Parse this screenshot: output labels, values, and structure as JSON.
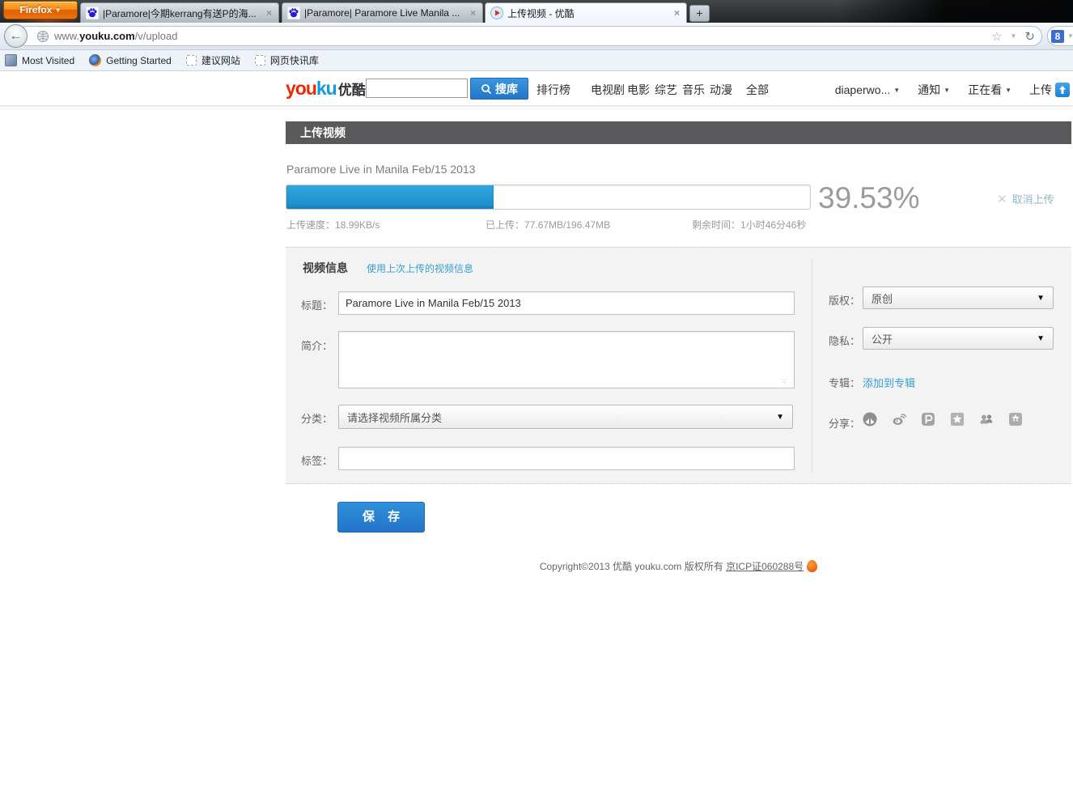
{
  "browser": {
    "firefox_button": "Firefox",
    "tabs": [
      {
        "title": "|Paramore|今期kerrang有送P的海...",
        "icon": "baidu-paw-icon",
        "active": false
      },
      {
        "title": "|Paramore| Paramore Live Manila ...",
        "icon": "baidu-paw-icon",
        "active": false
      },
      {
        "title": "上传视频 - 优酷",
        "icon": "youku-play-icon",
        "active": true
      }
    ],
    "url": {
      "prefix": "www.",
      "domain": "youku.com",
      "path": "/v/upload"
    },
    "bookmarks": [
      {
        "label": "Most Visited"
      },
      {
        "label": "Getting Started"
      },
      {
        "label": "建议网站"
      },
      {
        "label": "网页快讯库"
      }
    ]
  },
  "glyphs": {
    "caret_down": "▼",
    "close": "×",
    "plus": "+",
    "back_arrow": "←",
    "star": "☆",
    "reload": "↻",
    "google_8": "8",
    "cancel_x": "✕",
    "grip": "⁙"
  },
  "header": {
    "logo_you": "you",
    "logo_ku": "ku",
    "logo_cn": "优酷",
    "search_value": "",
    "search_button": "搜库",
    "ranking": "排行榜",
    "nav": [
      "电视剧",
      "电影",
      "综艺",
      "音乐",
      "动漫",
      "全部"
    ],
    "username": "diaperwo...",
    "notifications": "通知",
    "watching": "正在看",
    "upload": "上传"
  },
  "upload": {
    "section_title": "上传视频",
    "video_title": "Paramore Live in Manila Feb/15 2013",
    "percent_label": "39.53%",
    "percent_value": 39.53,
    "cancel_label": "取消上传",
    "speed_label": "上传速度：",
    "speed_value": "18.99KB/s",
    "uploaded_label": "已上传：",
    "uploaded_value": "77.67MB/196.47MB",
    "remaining_label": "剩余时间：",
    "remaining_value": "1小时46分46秒"
  },
  "form": {
    "info_title": "视频信息",
    "reuse_link": "使用上次上传的视频信息",
    "title_label": "标题：",
    "title_value": "Paramore Live in Manila Feb/15 2013",
    "desc_label": "简介：",
    "desc_value": "",
    "category_label": "分类：",
    "category_value": "请选择视频所属分类",
    "tags_label": "标签：",
    "tags_value": "",
    "copyright_label": "版权：",
    "copyright_value": "原创",
    "privacy_label": "隐私：",
    "privacy_value": "公开",
    "album_label": "专辑：",
    "album_link": "添加到专辑",
    "share_label": "分享：",
    "share_icons": [
      "renren-icon",
      "weibo-icon",
      "pengyou-icon",
      "qzone-icon",
      "qq-friends-icon",
      "kaixin-icon"
    ],
    "save_button": "保 存"
  },
  "footer": {
    "copyright_text": "Copyright©2013 优酷 youku.com 版权所有 ",
    "icp_link": "京ICP证060288号"
  },
  "colors": {
    "accent_blue": "#2376c9",
    "progress_blue": "#1b8cc9",
    "logo_red": "#f02800",
    "logo_blue": "#0f9ae0",
    "section_bar": "#59595b",
    "link_blue": "#36a0ce",
    "firefox_orange": "#f78e1e"
  }
}
